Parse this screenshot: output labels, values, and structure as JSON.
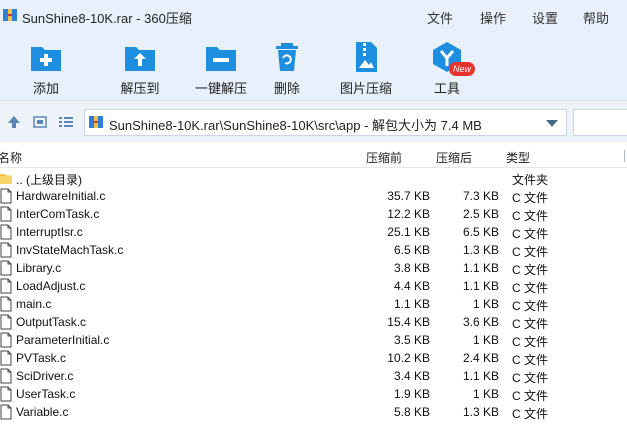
{
  "title": "SunShine8-10K.rar - 360压缩",
  "menu": [
    "文件",
    "操作",
    "设置",
    "帮助"
  ],
  "toolbar": {
    "items": [
      {
        "label": "添加",
        "icon": "add-icon"
      },
      {
        "label": "解压到",
        "icon": "extract-to-icon"
      },
      {
        "label": "一键解压",
        "icon": "one-click-extract-icon"
      },
      {
        "label": "删除",
        "icon": "delete-icon"
      },
      {
        "label": "图片压缩",
        "icon": "image-compress-icon"
      },
      {
        "label": "工具",
        "icon": "tools-icon"
      }
    ],
    "new_badge": "New"
  },
  "address": {
    "path": "SunShine8-10K.rar\\SunShine8-10K\\src\\app - 解包大小为 7.4 MB"
  },
  "columns": {
    "name": "名称",
    "size": "压缩前",
    "packed": "压缩后",
    "type": "类型"
  },
  "rows": [
    {
      "name": ".. (上级目录)",
      "size": "",
      "packed": "",
      "type": "文件夹",
      "kind": "folder"
    },
    {
      "name": "HardwareInitial.c",
      "size": "35.7 KB",
      "packed": "7.3 KB",
      "type": "C 文件",
      "kind": "file"
    },
    {
      "name": "InterComTask.c",
      "size": "12.2 KB",
      "packed": "2.5 KB",
      "type": "C 文件",
      "kind": "file"
    },
    {
      "name": "InterruptIsr.c",
      "size": "25.1 KB",
      "packed": "6.5 KB",
      "type": "C 文件",
      "kind": "file"
    },
    {
      "name": "InvStateMachTask.c",
      "size": "6.5 KB",
      "packed": "1.3 KB",
      "type": "C 文件",
      "kind": "file"
    },
    {
      "name": "Library.c",
      "size": "3.8 KB",
      "packed": "1.1 KB",
      "type": "C 文件",
      "kind": "file"
    },
    {
      "name": "LoadAdjust.c",
      "size": "4.4 KB",
      "packed": "1.1 KB",
      "type": "C 文件",
      "kind": "file"
    },
    {
      "name": "main.c",
      "size": "1.1 KB",
      "packed": "1 KB",
      "type": "C 文件",
      "kind": "file"
    },
    {
      "name": "OutputTask.c",
      "size": "15.4 KB",
      "packed": "3.6 KB",
      "type": "C 文件",
      "kind": "file"
    },
    {
      "name": "ParameterInitial.c",
      "size": "3.5 KB",
      "packed": "1 KB",
      "type": "C 文件",
      "kind": "file"
    },
    {
      "name": "PVTask.c",
      "size": "10.2 KB",
      "packed": "2.4 KB",
      "type": "C 文件",
      "kind": "file"
    },
    {
      "name": "SciDriver.c",
      "size": "3.4 KB",
      "packed": "1.1 KB",
      "type": "C 文件",
      "kind": "file"
    },
    {
      "name": "UserTask.c",
      "size": "1.9 KB",
      "packed": "1 KB",
      "type": "C 文件",
      "kind": "file"
    },
    {
      "name": "Variable.c",
      "size": "5.8 KB",
      "packed": "1.3 KB",
      "type": "C 文件",
      "kind": "file"
    }
  ],
  "colors": {
    "accent": "#1e8ee0",
    "chrome": "#e8f1fb",
    "badge": "#e8322c",
    "folder": "#f5c342"
  }
}
